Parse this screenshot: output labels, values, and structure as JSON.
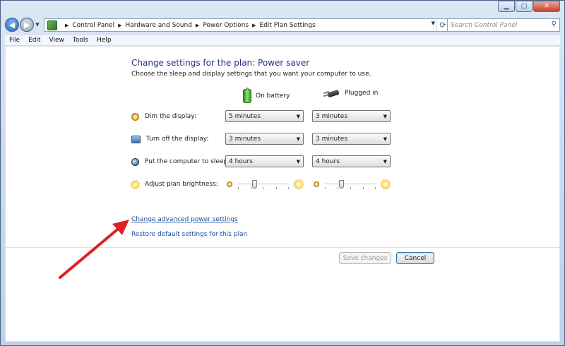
{
  "window": {
    "caption_buttons": {
      "minimize": "▁",
      "maximize": "□",
      "close": "✕"
    }
  },
  "address_bar": {
    "breadcrumbs": [
      "Control Panel",
      "Hardware and Sound",
      "Power Options",
      "Edit Plan Settings"
    ],
    "separator": "▶",
    "search_placeholder": "Search Control Panel"
  },
  "menu": [
    "File",
    "Edit",
    "View",
    "Tools",
    "Help"
  ],
  "page": {
    "title": "Change settings for the plan: Power saver",
    "subtitle": "Choose the sleep and display settings that you want your computer to use.",
    "columns": {
      "battery": "On battery",
      "plugged": "Plugged in"
    }
  },
  "settings": [
    {
      "label": "Dim the display:",
      "icon": "dim-display-icon",
      "battery": "5 minutes",
      "plugged": "3 minutes"
    },
    {
      "label": "Turn off the display:",
      "icon": "display-off-icon",
      "battery": "3 minutes",
      "plugged": "3 minutes"
    },
    {
      "label": "Put the computer to sleep:",
      "icon": "sleep-icon",
      "battery": "4 hours",
      "plugged": "4 hours"
    }
  ],
  "brightness": {
    "label": "Adjust plan brightness:",
    "battery_level": 0.3,
    "plugged_level": 0.3
  },
  "links": {
    "advanced": "Change advanced power settings",
    "restore": "Restore default settings for this plan"
  },
  "buttons": {
    "save": "Save changes",
    "cancel": "Cancel"
  },
  "colors": {
    "title": "#1e3287",
    "link": "#1b4f9c",
    "annotation_arrow": "#e02020"
  }
}
